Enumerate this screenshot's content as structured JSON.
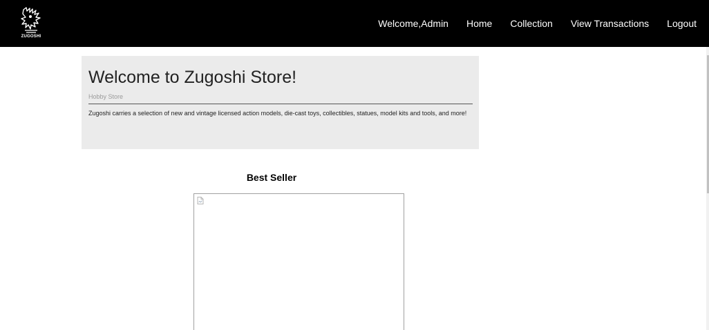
{
  "navbar": {
    "logo_text": "ZUGOSHI",
    "greeting": "Welcome,Admin",
    "links": [
      {
        "label": "Home"
      },
      {
        "label": "Collection"
      },
      {
        "label": "View Transactions"
      },
      {
        "label": "Logout"
      }
    ]
  },
  "hero": {
    "title": "Welcome to Zugoshi Store!",
    "subtitle": "Hobby Store",
    "description": "Zugoshi carries a selection of new and vintage licensed action models, die-cast toys, collectibles, statues, model kits and tools, and more!"
  },
  "best_seller": {
    "title": "Best Seller",
    "image_icon": "broken-image-icon"
  },
  "colors": {
    "navbar_bg": "#000000",
    "hero_bg": "#ebebeb"
  }
}
